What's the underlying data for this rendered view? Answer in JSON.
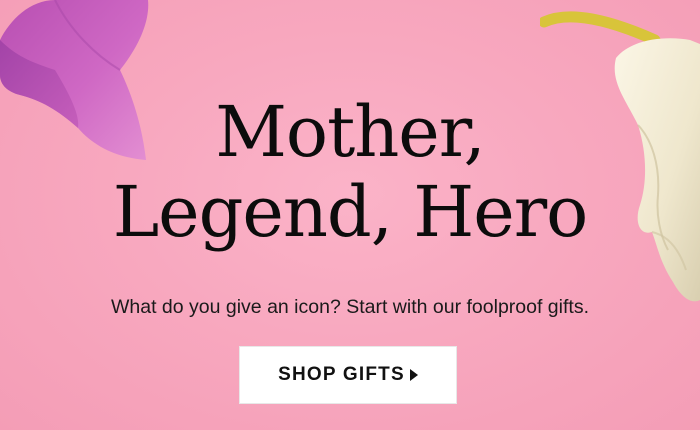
{
  "banner": {
    "headline_line1": "Mother,",
    "headline_line2": "Legend, Hero",
    "subtitle": "What do you give an icon? Start with our foolproof gifts.",
    "cta_label": "SHOP GIFTS",
    "cta_icon": "caret-right-icon",
    "colors": {
      "background": "#f8a8bf",
      "text": "#0c0c0c",
      "button": "#ffffff",
      "petal": "#c85ab8",
      "flower": "#f3ecd6",
      "stamen": "#d9c535"
    }
  }
}
